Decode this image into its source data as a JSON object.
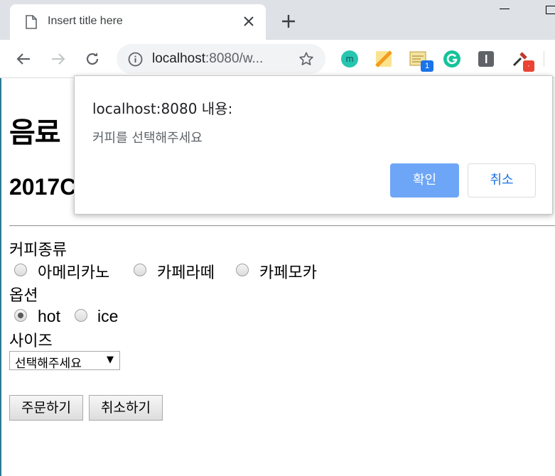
{
  "browser": {
    "tab_title": "Insert title here",
    "url_host": "localhost",
    "url_rest": ":8080/w..."
  },
  "extensions": [
    {
      "name": "m-extension-icon",
      "glyph": "m",
      "color": "#26c6b0"
    },
    {
      "name": "sticky-note-icon",
      "color": "#f5b642"
    },
    {
      "name": "notes-icon",
      "badge": "1",
      "color": "#e6d27a"
    },
    {
      "name": "grammarly-icon",
      "glyph": "G",
      "color": "#15c39a"
    },
    {
      "name": "i-extension-icon",
      "glyph": "I",
      "color": "#5f6368"
    },
    {
      "name": "eyedropper-icon",
      "badge": "·",
      "color": "#ea4335"
    }
  ],
  "page": {
    "heading": "음료",
    "subheading": "2017C",
    "coffee_label": "커피종류",
    "coffee_options": [
      "아메리카노",
      "카페라떼",
      "카페모카"
    ],
    "option_label": "옵션",
    "temp_options": [
      "hot",
      "ice"
    ],
    "temp_selected": "hot",
    "size_label": "사이즈",
    "size_select_value": "선택해주세요",
    "order_button": "주문하기",
    "cancel_button": "취소하기"
  },
  "dialog": {
    "title": "localhost:8080 내용:",
    "message": "커피를 선택해주세요",
    "ok_label": "확인",
    "cancel_label": "취소"
  }
}
